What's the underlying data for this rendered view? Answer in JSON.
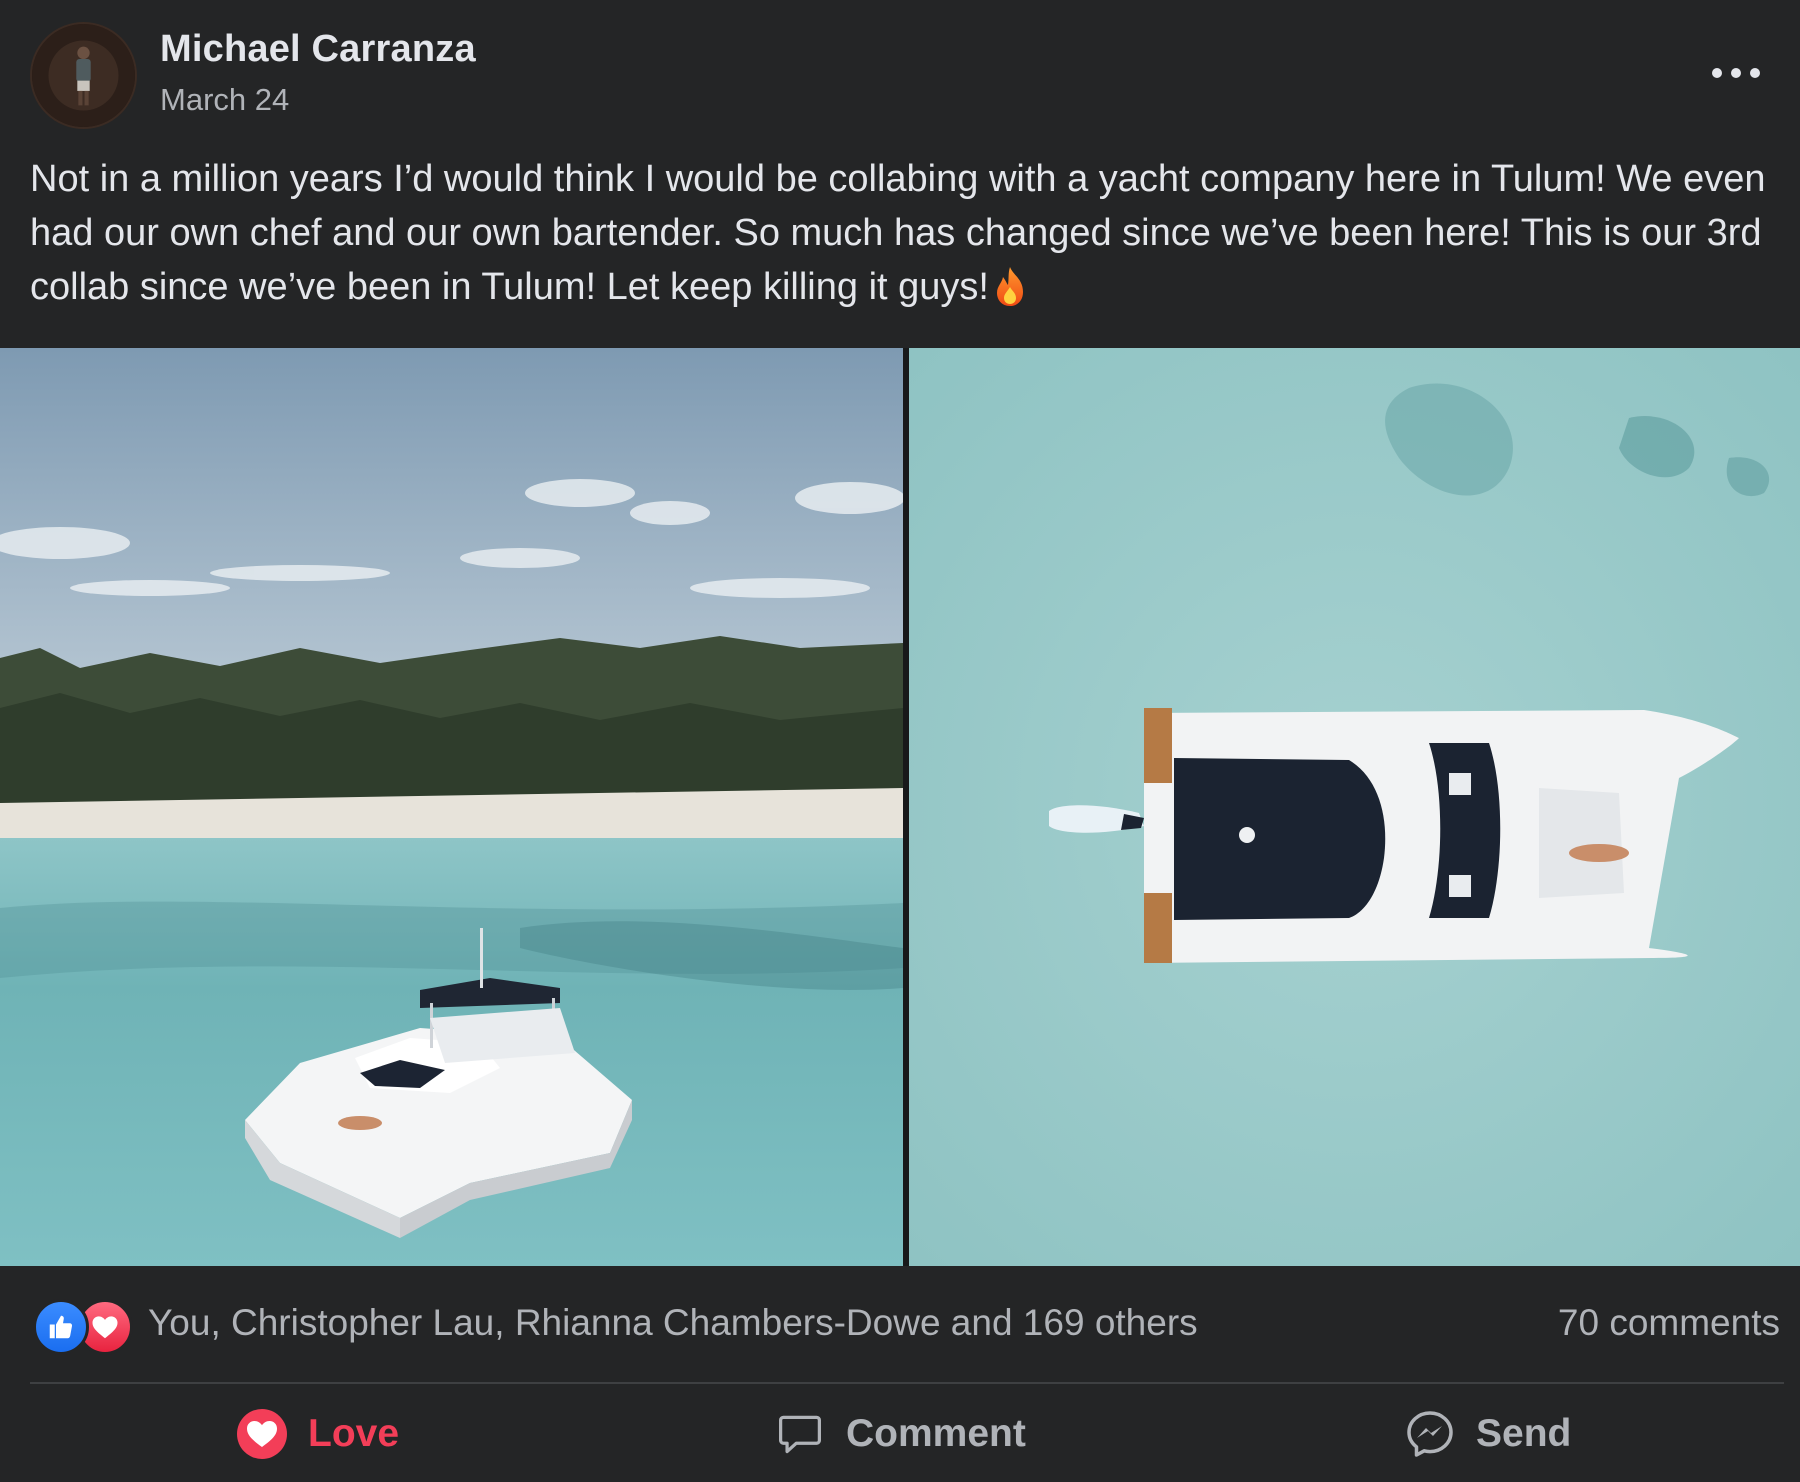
{
  "post": {
    "author": "Michael Carranza",
    "date": "March 24",
    "text": "Not in a million years I’d would think I would be collabing with a yacht company here in Tulum! We even had our own chef and our own bartender. So much has changed since we’ve been here! This is our 3rd collab since we’ve been in Tulum! Let keep killing it guys!",
    "emoji": "fire-emoji"
  },
  "photos": [
    {
      "name": "yacht-near-beach-photo"
    },
    {
      "name": "yacht-aerial-topdown-photo"
    }
  ],
  "reactions": {
    "icons": [
      "like-icon",
      "love-icon"
    ],
    "summary": "You, Christopher Lau, Rhianna Chambers-Dowe and 169 others",
    "comments": "70 comments"
  },
  "actions": {
    "love": "Love",
    "comment": "Comment",
    "send": "Send"
  },
  "colors": {
    "background": "#242526",
    "text_primary": "#e4e6eb",
    "text_secondary": "#b0b3b8",
    "love": "#f33e58",
    "like": "#1a6ef0"
  }
}
